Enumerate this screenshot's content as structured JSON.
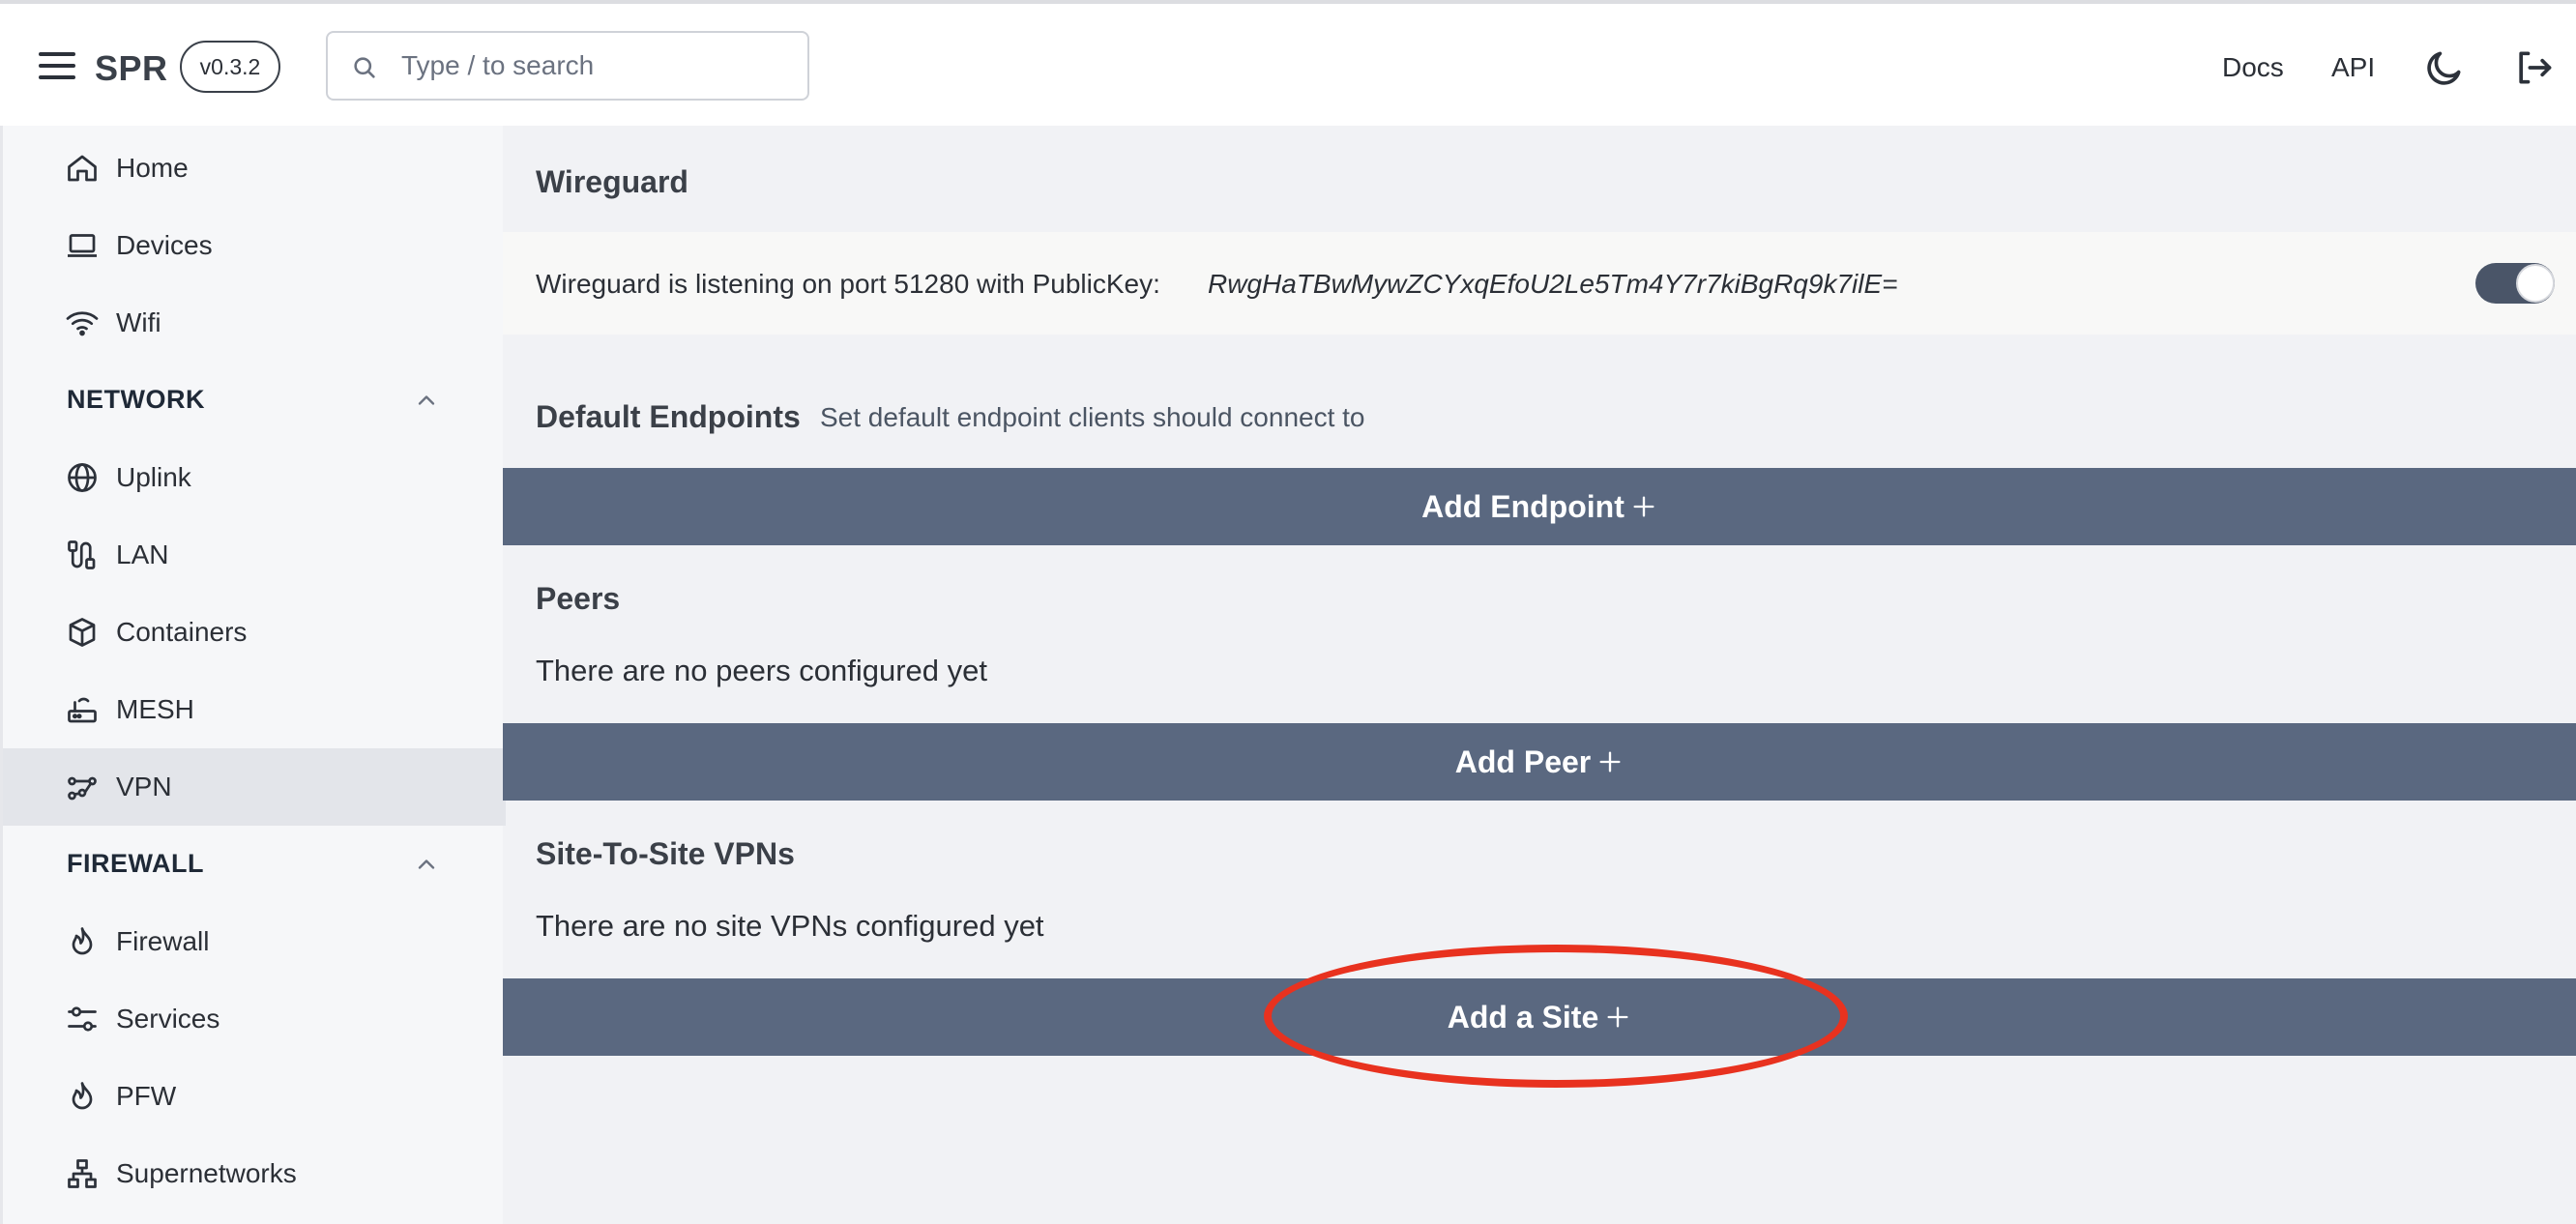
{
  "header": {
    "brand": "SPR",
    "version": "v0.3.2",
    "search_placeholder": "Type / to search",
    "links": {
      "docs": "Docs",
      "api": "API"
    }
  },
  "sidebar": {
    "items": [
      {
        "label": "Home",
        "icon": "home-icon"
      },
      {
        "label": "Devices",
        "icon": "laptop-icon"
      },
      {
        "label": "Wifi",
        "icon": "wifi-icon"
      }
    ],
    "network": {
      "title": "NETWORK",
      "items": [
        {
          "label": "Uplink",
          "icon": "globe-icon"
        },
        {
          "label": "LAN",
          "icon": "cable-icon"
        },
        {
          "label": "Containers",
          "icon": "cube-icon"
        },
        {
          "label": "MESH",
          "icon": "router-icon"
        },
        {
          "label": "VPN",
          "icon": "vpn-icon",
          "active": true
        }
      ]
    },
    "firewall": {
      "title": "FIREWALL",
      "items": [
        {
          "label": "Firewall",
          "icon": "flame-icon"
        },
        {
          "label": "Services",
          "icon": "sliders-icon"
        },
        {
          "label": "PFW",
          "icon": "flame-icon"
        },
        {
          "label": "Supernetworks",
          "icon": "sitemap-icon"
        }
      ]
    }
  },
  "main": {
    "title": "Wireguard",
    "status_text": "Wireguard is listening on port 51280 with PublicKey:",
    "public_key": "RwgHaTBwMywZCYxqEfoU2Le5Tm4Y7r7kiBgRq9k7ilE=",
    "enabled": true,
    "endpoints": {
      "title": "Default Endpoints",
      "subtitle": "Set default endpoint clients should connect to",
      "button": "Add Endpoint"
    },
    "peers": {
      "title": "Peers",
      "empty": "There are no peers configured yet",
      "button": "Add Peer"
    },
    "sites": {
      "title": "Site-To-Site VPNs",
      "empty": "There are no site VPNs configured yet",
      "button": "Add a Site"
    }
  },
  "colors": {
    "action_bar": "#5a6880",
    "highlight": "#e8321f",
    "active_item": "#e3e5ea"
  }
}
